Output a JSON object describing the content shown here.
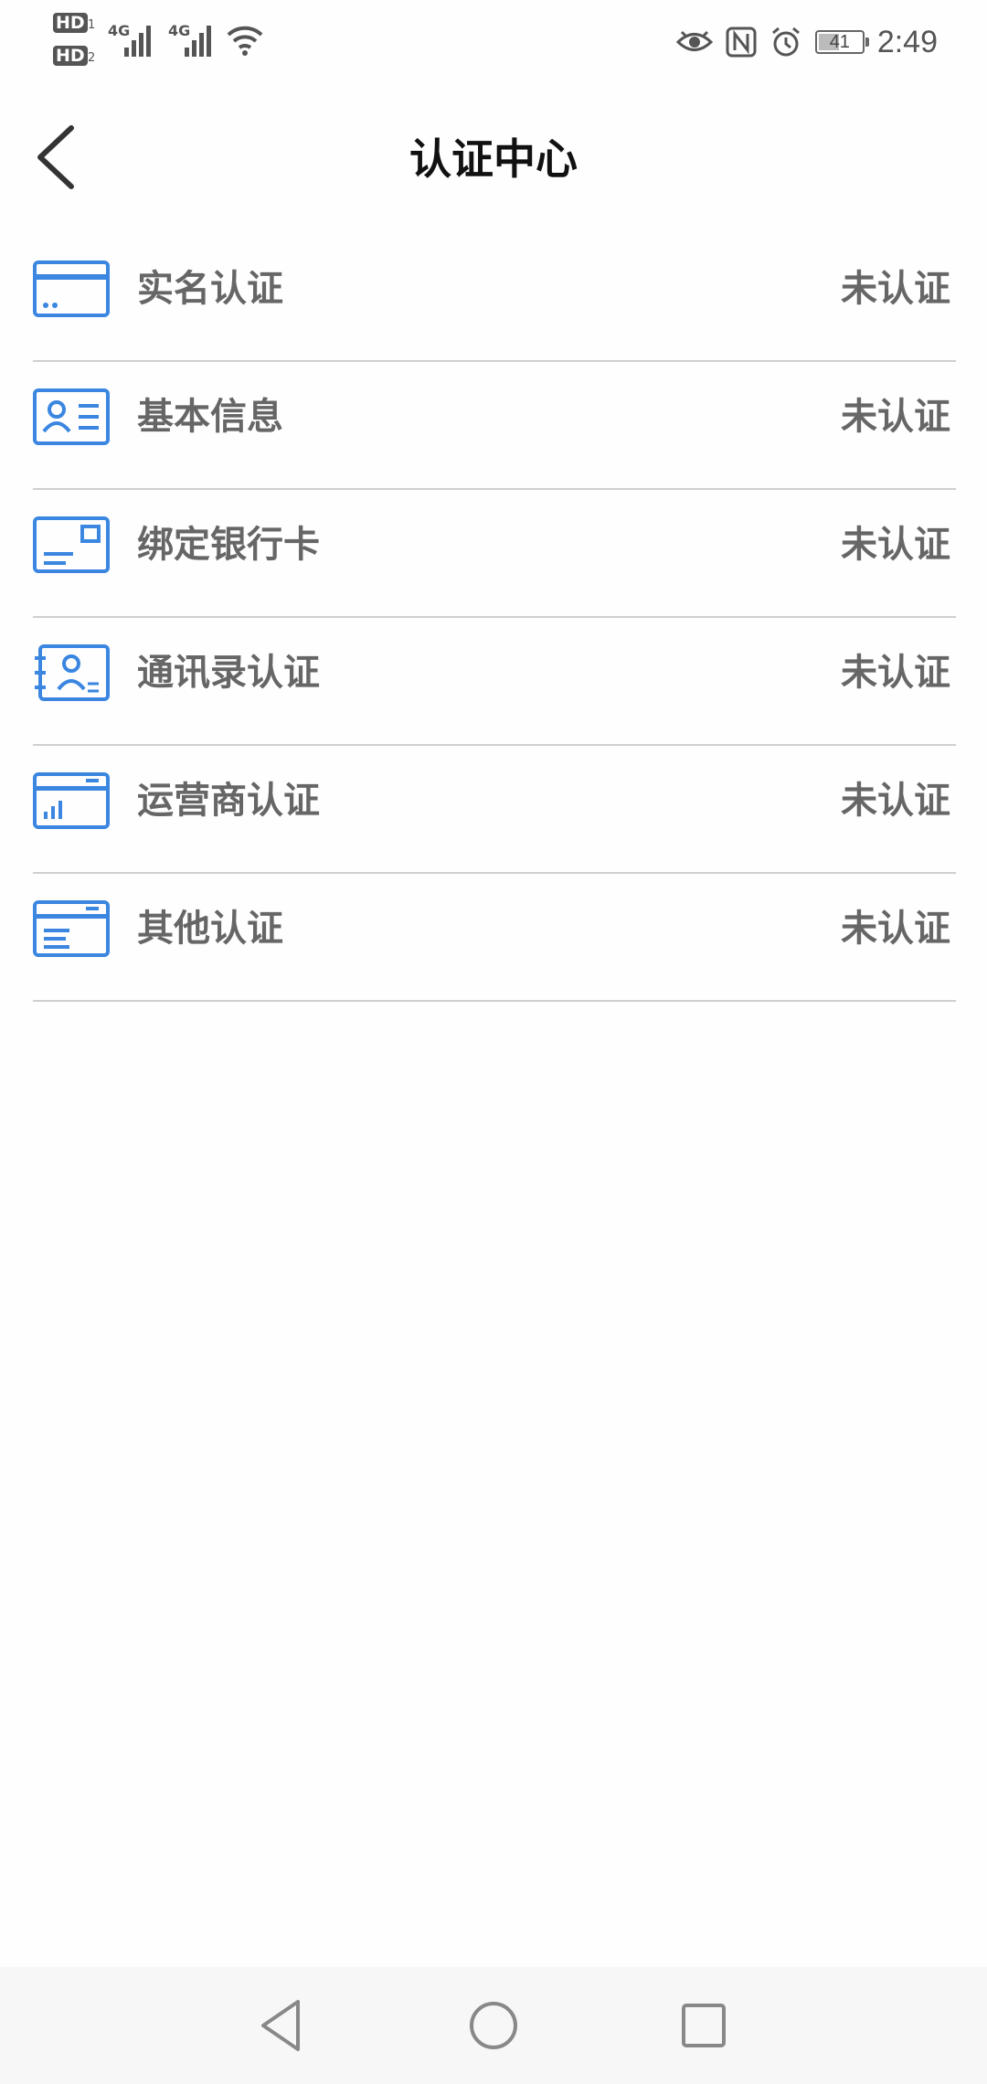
{
  "status_bar": {
    "sim1": "HD",
    "sim1_index": "1",
    "sim2": "HD",
    "sim2_index": "2",
    "net1": "4G",
    "net2": "4G",
    "battery": "41",
    "time": "2:49",
    "icons": [
      "eye-icon",
      "nfc-icon",
      "alarm-icon",
      "wifi-icon"
    ]
  },
  "header": {
    "title": "认证中心",
    "back_icon": "chevron-left-icon"
  },
  "accent_color": "#3a86e0",
  "items": [
    {
      "label": "实名认证",
      "status": "未认证",
      "icon": "id-card-icon"
    },
    {
      "label": "基本信息",
      "status": "未认证",
      "icon": "profile-card-icon"
    },
    {
      "label": "绑定银行卡",
      "status": "未认证",
      "icon": "bank-card-icon"
    },
    {
      "label": "通讯录认证",
      "status": "未认证",
      "icon": "contacts-book-icon"
    },
    {
      "label": "运营商认证",
      "status": "未认证",
      "icon": "carrier-chart-icon"
    },
    {
      "label": "其他认证",
      "status": "未认证",
      "icon": "document-card-icon"
    }
  ],
  "nav": {
    "icons": [
      "back-triangle-icon",
      "home-circle-icon",
      "recents-square-icon"
    ]
  }
}
